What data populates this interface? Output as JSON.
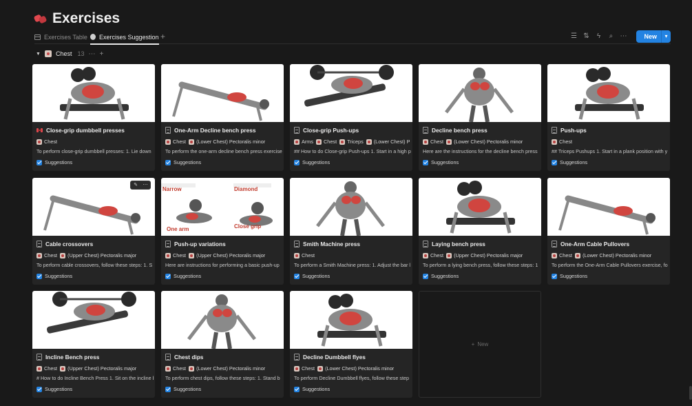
{
  "page": {
    "title": "Exercises"
  },
  "tabs": [
    {
      "label": "Exercises Table"
    },
    {
      "label": "Exercises Suggestion"
    }
  ],
  "toolbar": {
    "new_label": "New"
  },
  "group": {
    "name": "Chest",
    "count": "13"
  },
  "cards": [
    {
      "title": "Close-grip dumbbell presses",
      "icon": "dumbbell-icon",
      "tags": [
        "Chest"
      ],
      "description": "To perform close-grip dumbbell presses: 1. Lie down",
      "checkbox_label": "Suggestions"
    },
    {
      "title": "One-Arm Decline bench press",
      "icon": "document-icon",
      "tags": [
        "Chest",
        "(Lower Chest) Pectoralis minor"
      ],
      "description": "To perform the one-arm decline bench press exercise",
      "checkbox_label": "Suggestions"
    },
    {
      "title": "Close-grip Push-ups",
      "icon": "document-icon",
      "tags": [
        "Arms",
        "Chest",
        "Triceps",
        "(Lower Chest) Pe"
      ],
      "description": "## How to do Close-grip Push-ups 1. Start in a high p",
      "checkbox_label": "Suggestions"
    },
    {
      "title": "Decline bench press",
      "icon": "document-icon",
      "tags": [
        "Chest",
        "(Lower Chest) Pectoralis minor"
      ],
      "description": "Here are the instructions for the decline bench press",
      "checkbox_label": "Suggestions"
    },
    {
      "title": "Push-ups",
      "icon": "document-icon",
      "tags": [
        "Chest"
      ],
      "description": "## Triceps Pushups 1. Start in a plank position with y",
      "checkbox_label": "Suggestions"
    },
    {
      "title": "Cable crossovers",
      "icon": "document-icon",
      "tags": [
        "Chest",
        "(Upper Chest) Pectoralis major"
      ],
      "description": "To perform cable crossovers, follow these steps: 1. S",
      "checkbox_label": "Suggestions"
    },
    {
      "title": "Push-up variations",
      "icon": "document-icon",
      "tags": [
        "Chest",
        "(Upper Chest) Pectoralis major"
      ],
      "description": "Here are instructions for performing a basic push-up",
      "checkbox_label": "Suggestions",
      "cover_text": [
        "Narrow",
        "Diamond",
        "One arm",
        "Close grip"
      ]
    },
    {
      "title": "Smith Machine press",
      "icon": "document-icon",
      "tags": [
        "Chest"
      ],
      "description": "To perform a Smith Machine press: 1. Adjust the bar l",
      "checkbox_label": "Suggestions"
    },
    {
      "title": "Laying bench press",
      "icon": "document-icon",
      "tags": [
        "Chest",
        "(Upper Chest) Pectoralis major"
      ],
      "description": "To perform a lying bench press, follow these steps: 1",
      "checkbox_label": "Suggestions"
    },
    {
      "title": "One-Arm Cable Pullovers",
      "icon": "document-icon",
      "tags": [
        "Chest",
        "(Lower Chest) Pectoralis minor"
      ],
      "description": "To perform the One-Arm Cable Pullovers exercise, fo",
      "checkbox_label": "Suggestions"
    },
    {
      "title": "Incline Bench press",
      "icon": "document-icon",
      "tags": [
        "Chest",
        "(Upper Chest) Pectoralis major"
      ],
      "description": "# How to do Incline Bench Press 1. Sit on the incline b",
      "checkbox_label": "Suggestions"
    },
    {
      "title": "Chest dips",
      "icon": "document-icon",
      "tags": [
        "Chest",
        "(Lower Chest) Pectoralis minor"
      ],
      "description": "To perform chest dips, follow these steps: 1. Stand b",
      "checkbox_label": "Suggestions"
    },
    {
      "title": "Decline Dumbbell flyes",
      "icon": "document-icon",
      "tags": [
        "Chest",
        "(Lower Chest) Pectoralis minor"
      ],
      "description": "To perform Decline Dumbbell flyes, follow these step",
      "checkbox_label": "Suggestions"
    }
  ],
  "new_card": {
    "label": "New"
  },
  "colors": {
    "background": "#191919",
    "card": "#252525",
    "accent": "#2383e2",
    "muscle": "#d0453f"
  }
}
